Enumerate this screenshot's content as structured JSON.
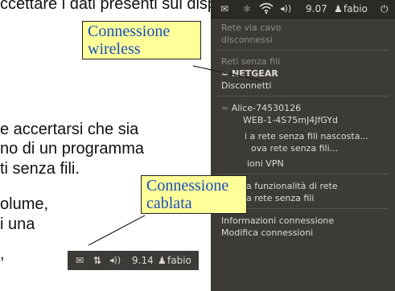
{
  "doc": {
    "top_line": "ccettare i dati presenti sul dispositivi",
    "para1": [
      "e accertarsi che sia",
      "no di un programma",
      "ti senza fili."
    ],
    "para2": [
      "olume,",
      "i una",
      ","
    ]
  },
  "callouts": {
    "wireless": [
      "Connessione",
      "wireless"
    ],
    "wired": [
      "Connessione",
      "cablata"
    ]
  },
  "topbar": {
    "mail_icon": "✉",
    "bluetooth_icon": "✱",
    "wifi_icon": "◠",
    "volume_icon": "◂))",
    "time": "9.07",
    "user_icon": "♟",
    "user": "fabio",
    "power_icon": "⏻"
  },
  "menu": {
    "wired_header": "Rete via cavo",
    "wired_status": "disconnessi",
    "wireless_header": "Reti senza fili",
    "network_connected": "NETGEAR",
    "disconnect": "Disconnetti",
    "network_2": "Alice-74530126",
    "network_3": "WEB-1-4S75mJ4JfGYd",
    "hidden_network": "i a rete senza fili nascosta...",
    "new_network": "ova rete senza fili...",
    "vpn": "ioni VPN",
    "enable_networking": "Abilita funzionalità di rete",
    "enable_wireless": "Abilita rete senza fili",
    "connection_info": "Informazioni connessione",
    "edit_connections": "Modifica connessioni"
  },
  "minibar": {
    "mail_icon": "✉",
    "updown_icon": "⇅",
    "volume_icon": "◂))",
    "time": "9.14",
    "user_icon": "♟",
    "user": "fabio",
    "power_icon": "⏻"
  }
}
